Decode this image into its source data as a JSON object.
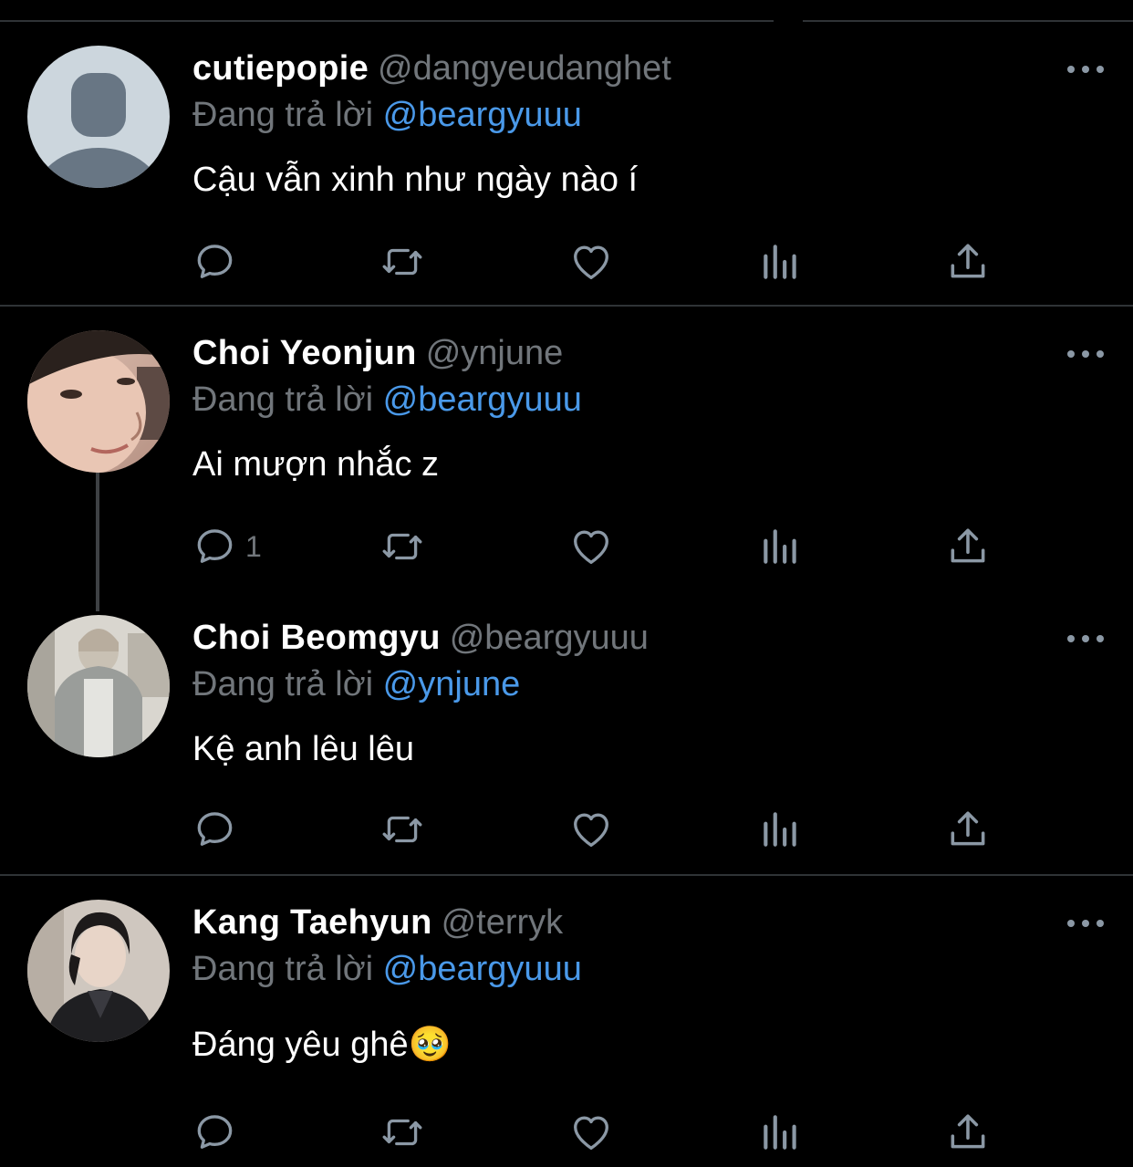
{
  "tweets": [
    {
      "name": "cutiepopie",
      "handle": "@dangyeudanghet",
      "replying_prefix": "Đang trả lời",
      "replying_to": "@beargyuuu",
      "text": "Cậu vẫn xinh như ngày nào í",
      "reply_count": "",
      "avatar": "default-profile-avatar"
    },
    {
      "name": "Choi Yeonjun",
      "handle": "@ynjune",
      "replying_prefix": "Đang trả lời",
      "replying_to": "@beargyuuu",
      "text": "Ai mượn nhắc z",
      "reply_count": "1",
      "avatar": "photo-avatar"
    },
    {
      "name": "Choi Beomgyu",
      "handle": "@beargyuuu",
      "replying_prefix": "Đang trả lời",
      "replying_to": "@ynjune",
      "text": "Kệ anh lêu lêu",
      "reply_count": "",
      "avatar": "photo-avatar"
    },
    {
      "name": "Kang Taehyun",
      "handle": "@terryk",
      "replying_prefix": "Đang trả lời",
      "replying_to": "@beargyuuu",
      "text": "Đáng yêu ghê🥹",
      "reply_count": "",
      "avatar": "photo-avatar"
    }
  ],
  "icons": {
    "reply": "reply-icon",
    "retweet": "retweet-icon",
    "like": "heart-icon",
    "views": "views-icon",
    "share": "share-icon",
    "more": "more-icon"
  },
  "colors": {
    "background": "#000000",
    "text": "#ffffff",
    "secondary": "#71767b",
    "link": "#4a99e9",
    "divider": "#2f3336"
  }
}
